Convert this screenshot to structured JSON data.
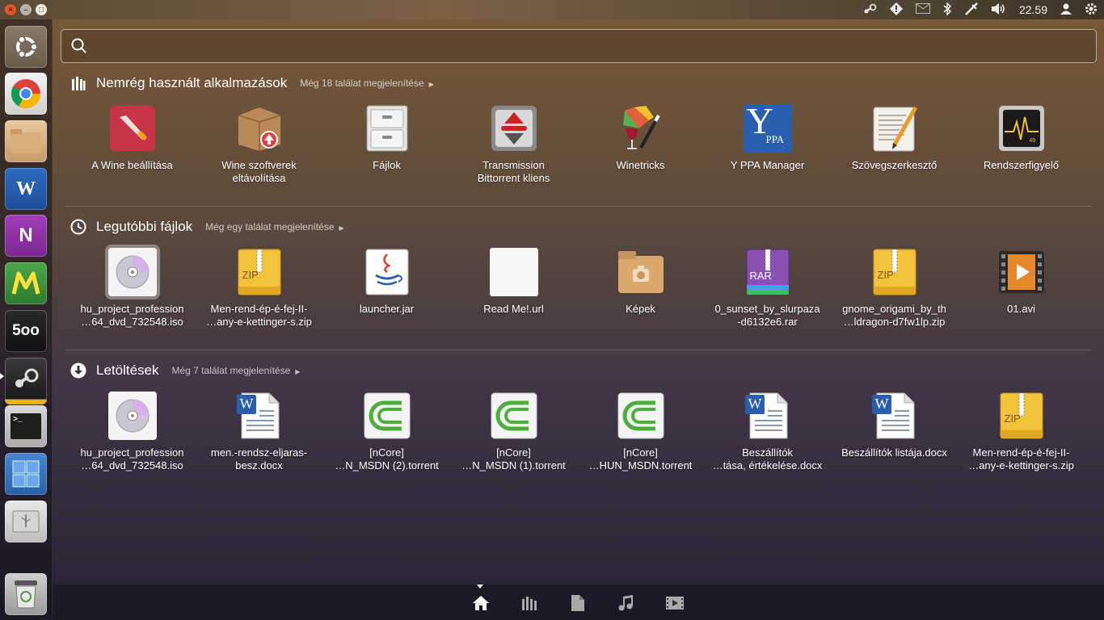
{
  "topbar": {
    "clock": "22.59"
  },
  "search": {
    "placeholder": "",
    "value": ""
  },
  "sections": [
    {
      "title": "Nemrég használt alkalmazások",
      "more": "Még 18 találat megjelenítése",
      "items": [
        {
          "line1": "A Wine beállítása",
          "line2": ""
        },
        {
          "line1": "Wine szoftverek",
          "line2": "eltávolítása"
        },
        {
          "line1": "Fájlok",
          "line2": ""
        },
        {
          "line1": "Transmission",
          "line2": "Bittorrent kliens"
        },
        {
          "line1": "Winetricks",
          "line2": ""
        },
        {
          "line1": "Y PPA Manager",
          "line2": ""
        },
        {
          "line1": "Szövegszerkesztő",
          "line2": ""
        },
        {
          "line1": "Rendszerfigyelő",
          "line2": ""
        }
      ]
    },
    {
      "title": "Legutóbbi fájlok",
      "more": "Még egy találat megjelenítése",
      "items": [
        {
          "line1": "hu_project_profession",
          "line2": "…64_dvd_732548.iso"
        },
        {
          "line1": "Men-rend-ép-é-fej-II-",
          "line2": "…any-e-kettinger-s.zip"
        },
        {
          "line1": "launcher.jar",
          "line2": ""
        },
        {
          "line1": "Read Me!.url",
          "line2": ""
        },
        {
          "line1": "Képek",
          "line2": ""
        },
        {
          "line1": "0_sunset_by_slurpaza",
          "line2": "-d6132e6.rar"
        },
        {
          "line1": "gnome_origami_by_th",
          "line2": "…ldragon-d7fw1lp.zip"
        },
        {
          "line1": "01.avi",
          "line2": ""
        }
      ]
    },
    {
      "title": "Letöltések",
      "more": "Még 7 találat megjelenítése",
      "items": [
        {
          "line1": "hu_project_profession",
          "line2": "…64_dvd_732548.iso"
        },
        {
          "line1": "men.-rendsz-eljaras-",
          "line2": "besz.docx"
        },
        {
          "line1": "[nCore]",
          "line2": "…N_MSDN (2).torrent"
        },
        {
          "line1": "[nCore]",
          "line2": "…N_MSDN (1).torrent"
        },
        {
          "line1": "[nCore]",
          "line2": "…HUN_MSDN.torrent"
        },
        {
          "line1": "Beszállítók",
          "line2": "…tása, értékelése.docx"
        },
        {
          "line1": "Beszállítók listája.docx",
          "line2": ""
        },
        {
          "line1": "Men-rend-ép-é-fej-II-",
          "line2": "…any-e-kettinger-s.zip"
        }
      ]
    }
  ],
  "icon_labels": {
    "zip": "ZIP",
    "rar": "RAR",
    "ppa_big": "Y",
    "ppa_small": "PPA",
    "px500": "5oo",
    "terminal": ">_",
    "word": "W",
    "onenote": "N",
    "monitor_readout": "49"
  },
  "colors": {
    "accent": "#e2552b",
    "zip": "#f2c33a",
    "rar": "#8a4fb5",
    "torrent": "#4caf3c"
  }
}
